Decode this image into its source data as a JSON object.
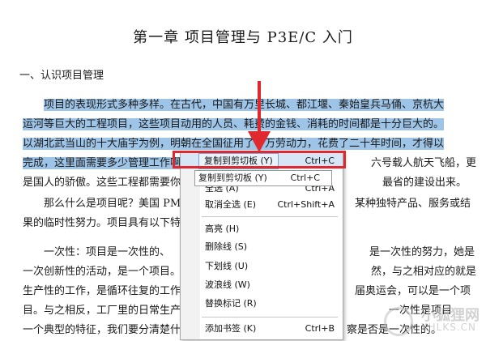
{
  "document": {
    "title": "第一章   项目管理与 P3E/C 入门",
    "section": "一、认识项目管理",
    "para1": [
      "项目的表现形式多种多样。在古代，中国有万里长城、都江堰、秦始皇兵马俑、京杭大",
      "运河等巨大的工程项目，这些项目动用的人员、耗费的金钱、消耗的时间都是十分巨大的。",
      "以湖北武当山的十大庙宇为例，明朝在全国征用了十万劳动力，花费了二十年时间，才得以",
      "完成，这里面需要多少管理工作啊"
    ],
    "para1_tail": "六号载人航天飞船，更",
    "para1_line5_start": "是国人的骄傲。这些工程都需要你",
    "para1_line5_end": "最省的建设出来。",
    "para2_line1_start": "那么什么是项目呢？美国 PM",
    "para2_line1_end": "某种独特产品、服务或结",
    "para2_line2": "果的临时性努力。项目具有以下特",
    "para3_line1_start": "一次性：项目是一次性的、",
    "para3_line1_end": "是一次性的努力，她是",
    "para3_line2_start": "一次创新性的活动，是一个项目。",
    "para3_line2_end": "然，与之相对应的就是",
    "para3_line3_start": "生产性的工作，是循环往复的工作",
    "para3_line3_end": "届奥运会，可以是一个项",
    "para3_line4_start": "目。与之相反，工厂里的日常生产",
    "para3_line4_end": "一次性是项目",
    "para3_line5_start": "一个典型的特征，我们要分清楚什么",
    "para3_line5_end": "察是否是一次性的。"
  },
  "context_menu": {
    "items": [
      {
        "label": "复制到剪切板 (Y)",
        "shortcut": "Ctrl+C",
        "active": true
      },
      {
        "label": "全选 (A)",
        "shortcut": "Ctrl+A"
      },
      {
        "label": "取消全选 (E)",
        "shortcut": "Ctrl+Shift+A"
      },
      {
        "label": "高亮 (H)",
        "shortcut": ""
      },
      {
        "label": "删除线 (S)",
        "shortcut": ""
      },
      {
        "label": "下划线 (U)",
        "shortcut": ""
      },
      {
        "label": "波浪线 (W)",
        "shortcut": ""
      },
      {
        "label": "替换标记 (R)",
        "shortcut": ""
      },
      {
        "label": "添加书签 (K)",
        "shortcut": "Ctrl+B"
      }
    ],
    "tooltip_label": "复制到剪切板 (Y)",
    "tooltip_shortcut": "Ctrl+C"
  },
  "watermark": {
    "main": "小狐狸网",
    "sub": "XHLKS.CN"
  },
  "colors": {
    "selection": "#9ec5e8",
    "highlight_box": "#e0282f",
    "arrow": "#e0282f"
  }
}
